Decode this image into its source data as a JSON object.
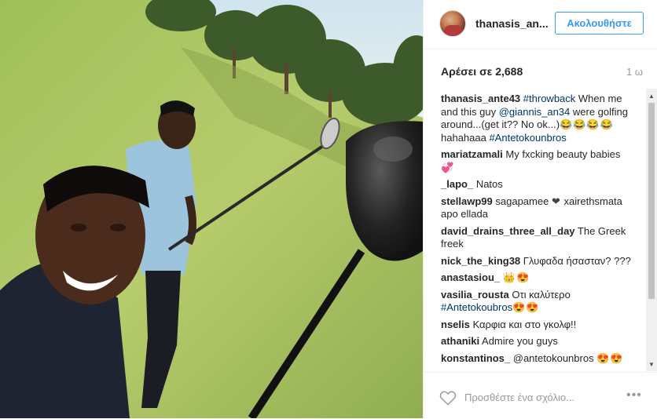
{
  "header": {
    "username": "thanasis_an...",
    "follow_label": "Ακολουθήστε"
  },
  "post": {
    "likes": "Αρέσει σε 2,688",
    "time": "1 ω"
  },
  "comments": [
    {
      "user": "thanasis_ante43",
      "parts": [
        {
          "t": "tag",
          "v": "#throwback"
        },
        {
          "t": "text",
          "v": " When me and this guy "
        },
        {
          "t": "tag",
          "v": "@giannis_an34"
        },
        {
          "t": "text",
          "v": " were golfing around...(get it?? No ok...)"
        },
        {
          "t": "emoji",
          "v": "😂😂😂😂"
        },
        {
          "t": "text",
          "v": "hahahaaa "
        },
        {
          "t": "tag",
          "v": "#Antetokounbros"
        }
      ]
    },
    {
      "user": "mariatzamali",
      "parts": [
        {
          "t": "text",
          "v": "My fxcking beauty babies "
        },
        {
          "t": "emoji",
          "v": "💞"
        }
      ]
    },
    {
      "user": "_lapo_",
      "parts": [
        {
          "t": "text",
          "v": "Natos"
        }
      ]
    },
    {
      "user": "stellawp99",
      "parts": [
        {
          "t": "text",
          "v": "sagapamee "
        },
        {
          "t": "emoji",
          "v": "❤"
        },
        {
          "t": "text",
          "v": " xairethsmata apo ellada"
        }
      ]
    },
    {
      "user": "david_drains_three_all_day",
      "parts": [
        {
          "t": "text",
          "v": "The Greek freek"
        }
      ]
    },
    {
      "user": "nick_the_king38",
      "parts": [
        {
          "t": "text",
          "v": "Γλυφαδα ήσασταν? ???"
        }
      ]
    },
    {
      "user": "anastasiou_",
      "parts": [
        {
          "t": "emoji",
          "v": "👑😍"
        }
      ]
    },
    {
      "user": "vasilia_rousta",
      "parts": [
        {
          "t": "text",
          "v": "Οτι καλύτερο "
        },
        {
          "t": "tag",
          "v": "#Antetokoubros"
        },
        {
          "t": "emoji",
          "v": "😍😍"
        }
      ]
    },
    {
      "user": "nselis",
      "parts": [
        {
          "t": "text",
          "v": "Καρφια και στο γκολφ!!"
        }
      ]
    },
    {
      "user": "athaniki",
      "parts": [
        {
          "t": "text",
          "v": "Admire you guys"
        }
      ]
    },
    {
      "user": "konstantinos_",
      "parts": [
        {
          "t": "text",
          "v": "@antetokounbros "
        },
        {
          "t": "emoji",
          "v": "😍😍"
        }
      ]
    }
  ],
  "footer": {
    "comment_placeholder": "Προσθέστε ένα σχόλιο...",
    "more_label": "•••"
  },
  "icons": {
    "heart": "heart-icon",
    "more": "more-options-icon",
    "scroll_up": "chevron-up-icon",
    "scroll_down": "chevron-down-icon"
  },
  "colors": {
    "accent": "#3897f0",
    "hashtag": "#003569",
    "muted": "#999999"
  }
}
